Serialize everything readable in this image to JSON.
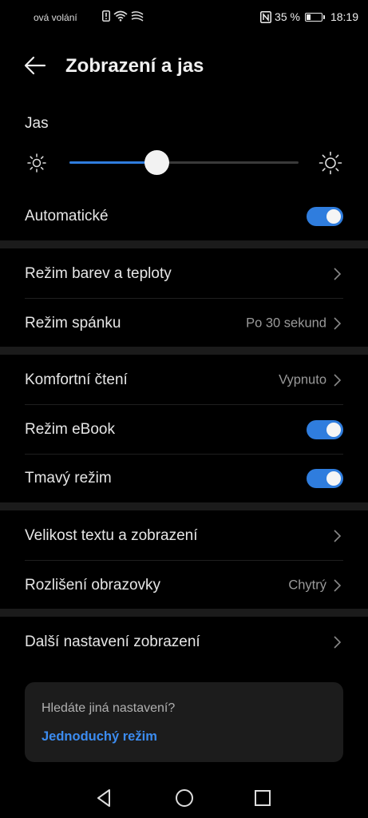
{
  "status_bar": {
    "carrier": "ová volání",
    "battery_percent": "35 %",
    "battery_level": 0.35,
    "time": "18:19",
    "icons": [
      "alert-icon",
      "wifi-icon",
      "signal-wave-icon",
      "nfc-icon",
      "battery-icon"
    ]
  },
  "header": {
    "title": "Zobrazení a jas",
    "back_icon": "back-arrow-icon"
  },
  "brightness": {
    "label": "Jas",
    "level": 0.38,
    "min_icon": "sun-small-icon",
    "max_icon": "sun-large-icon"
  },
  "rows": {
    "automatic": {
      "label": "Automatické",
      "toggle": true
    },
    "color_mode": {
      "label": "Režim barev a teploty"
    },
    "sleep": {
      "label": "Režim spánku",
      "value": "Po 30 sekund"
    },
    "comfort_reading": {
      "label": "Komfortní čtení",
      "value": "Vypnuto"
    },
    "ebook": {
      "label": "Režim eBook",
      "toggle": true
    },
    "dark_mode": {
      "label": "Tmavý režim",
      "toggle": true
    },
    "text_size": {
      "label": "Velikost textu a zobrazení"
    },
    "resolution": {
      "label": "Rozlišení obrazovky",
      "value": "Chytrý"
    },
    "more_display": {
      "label": "Další nastavení zobrazení"
    }
  },
  "suggestion_card": {
    "text": "Hledáte jiná nastavení?",
    "link": "Jednoduchý režim"
  },
  "colors": {
    "accent": "#2f7dde",
    "link": "#3c8cf0",
    "background": "#000000",
    "band": "#1b1b1b"
  },
  "nav_bar": {
    "icons": [
      "back-triangle-icon",
      "home-circle-icon",
      "recents-square-icon"
    ]
  }
}
